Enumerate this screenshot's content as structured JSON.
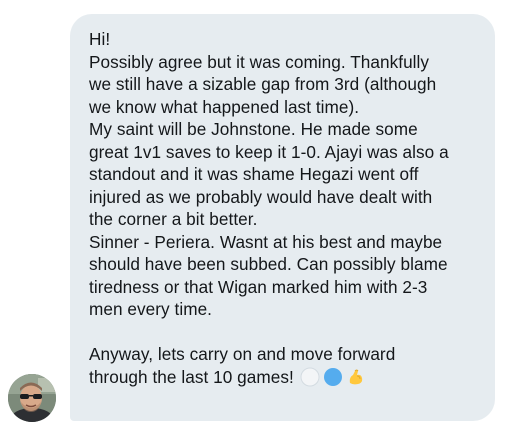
{
  "message": {
    "lines": [
      "Hi!",
      "Possibly agree but it was coming. Thankfully",
      "we still have a sizable gap from 3rd (although",
      "we know what happened last time).",
      "My saint will be Johnstone. He made some",
      "great 1v1 saves to keep it 1-0. Ajayi was also a",
      "standout and it was shame Hegazi went off",
      "injured as we probably would have dealt with",
      "the corner a bit better.",
      "Sinner - Periera. Wasnt at his best and maybe",
      "should have been subbed. Can possibly blame",
      "tiredness or that Wigan marked him with 2-3",
      "men every time.",
      "Anyway, lets carry on and move forward",
      "through the last 10 games!"
    ],
    "emojis": [
      "white-circle-emoji",
      "blue-circle-emoji",
      "flexed-biceps-emoji"
    ]
  },
  "colors": {
    "bubble_background": "#e6ecf0",
    "text": "#14171a",
    "page_background": "#ffffff"
  }
}
